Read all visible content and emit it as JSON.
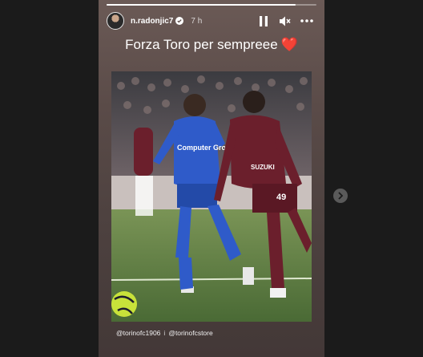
{
  "story": {
    "progress": 0.9,
    "username": "n.radonjic7",
    "time_ago": "7 h",
    "verified": true,
    "caption": "Forza Toro per sempreee",
    "caption_emoji": "❤️",
    "photo_description_icon": "football-match-photo",
    "photo_text": {
      "sponsor_home": "Computer Gross",
      "sponsor_away": "SUZUKI",
      "away_number": "49"
    },
    "mentions": [
      "@torinofc1906",
      "@torinofcstore"
    ],
    "mention_separator": "i"
  },
  "controls": {
    "pause_icon": "pause-icon",
    "mute_icon": "mute-icon",
    "more_icon": "more-options-icon"
  },
  "navigation": {
    "next_icon": "chevron-right-icon"
  },
  "colors": {
    "home_kit": "#2f5bc9",
    "away_kit": "#6b1f2c",
    "heart": "#ff3040",
    "background": "#1b1b1b"
  }
}
